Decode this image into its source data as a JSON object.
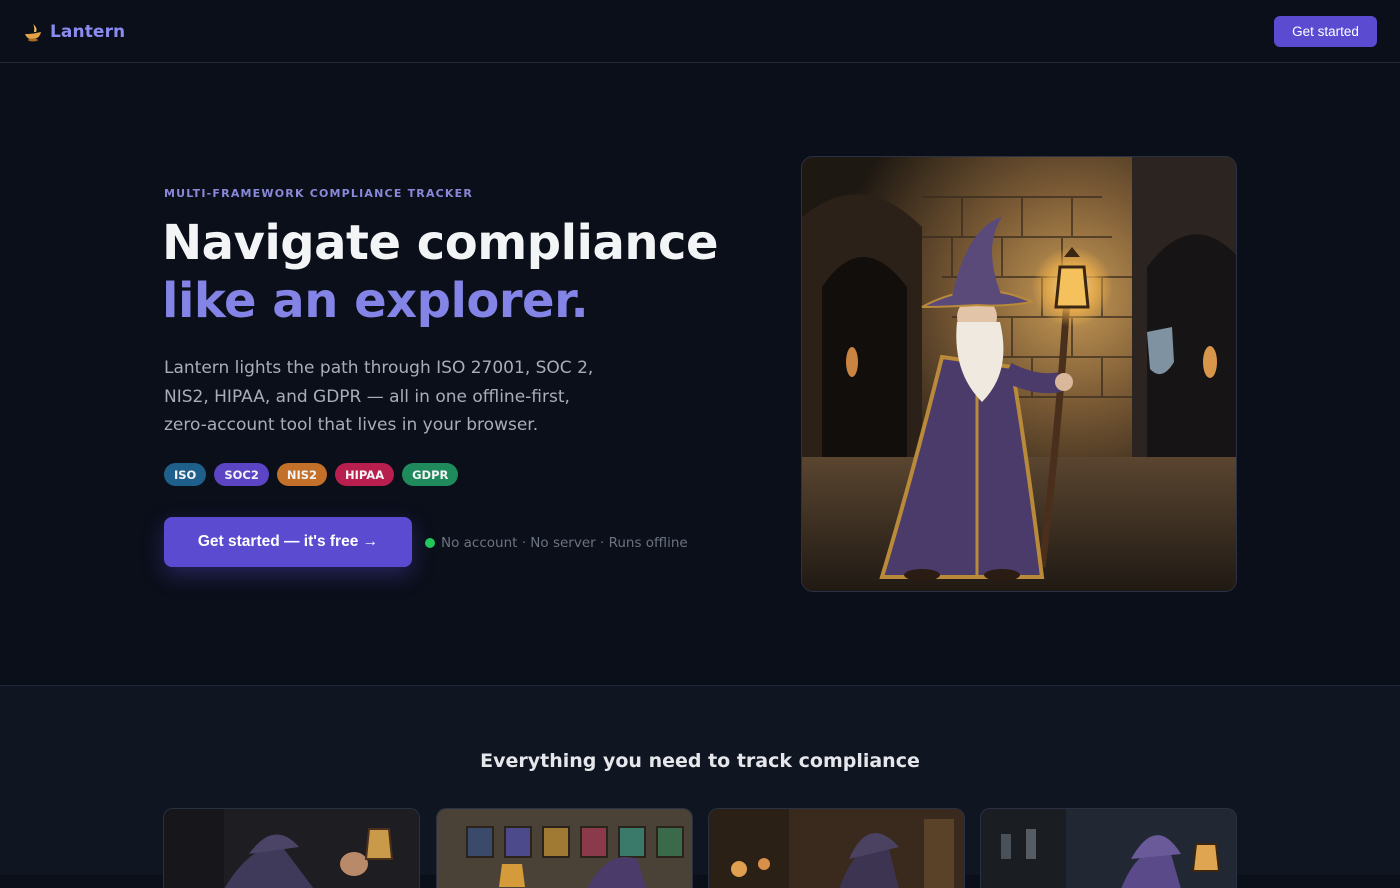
{
  "header": {
    "brand_name": "Lantern",
    "brand_icon": "oil-lamp-icon",
    "cta_label": "Get started"
  },
  "hero": {
    "eyebrow": "MULTI-FRAMEWORK COMPLIANCE TRACKER",
    "headline_line1": "Navigate compliance",
    "headline_line2": "like an explorer.",
    "subcopy": "Lantern lights the path through ISO 27001, SOC 2, NIS2, HIPAA, and GDPR — all in one offline-first, zero-account tool that lives in your browser.",
    "tags": [
      {
        "label": "ISO",
        "color": "#1f5f8b"
      },
      {
        "label": "SOC2",
        "color": "#5b45c4"
      },
      {
        "label": "NIS2",
        "color": "#c2702a"
      },
      {
        "label": "HIPAA",
        "color": "#b81f4e"
      },
      {
        "label": "GDPR",
        "color": "#1f8a5b"
      }
    ],
    "cta_label": "Get started — it's free →",
    "assurance": "No account · No server · Runs offline",
    "status_color": "#22c55e"
  },
  "features": {
    "title": "Everything you need to track compliance"
  },
  "colors": {
    "background": "#0b0f1a",
    "accent": "#5a4bd1",
    "headline_accent": "#8483e6"
  }
}
